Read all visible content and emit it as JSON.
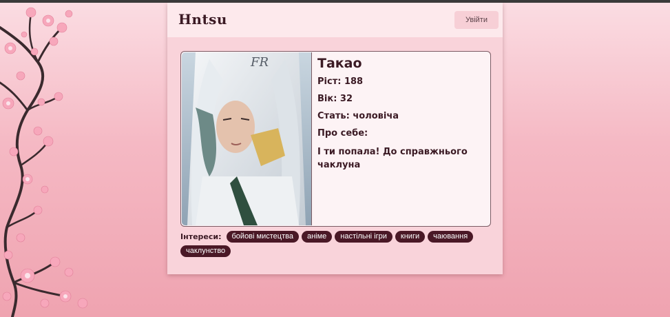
{
  "app": {
    "logo": "Hntsu",
    "login_label": "Увійти"
  },
  "profile": {
    "name": "Такао",
    "height_label": "Ріст:",
    "height_value": "188",
    "age_label": "Вік:",
    "age_value": "32",
    "gender_label": "Стать:",
    "gender_value": "чоловіча",
    "about_label": "Про себе:",
    "about_text": "І ти попала! До справжнього чаклуна",
    "photo_watermark": "FR"
  },
  "interests": {
    "label": "Інтереси:",
    "tags": [
      "бойові мистецтва",
      "аніме",
      "настільні ігри",
      "книги",
      "чаювання",
      "чаклунство"
    ]
  },
  "colors": {
    "tag_bg": "#4a1826",
    "accent_text": "#3b1a24",
    "card_bg": "#f9d3da",
    "header_bg": "#fde9ec"
  }
}
